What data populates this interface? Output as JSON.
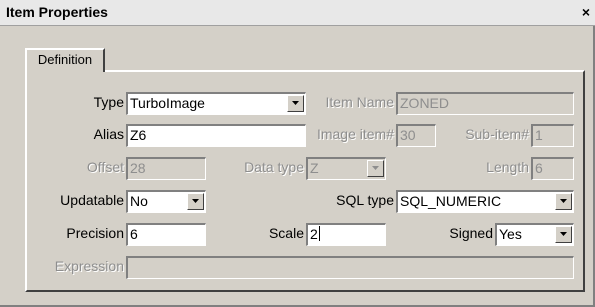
{
  "window": {
    "title": "Item Properties",
    "close_glyph": "×"
  },
  "tabs": [
    {
      "label": "Definition",
      "active": true
    }
  ],
  "form": {
    "type": {
      "label": "Type",
      "value": "TurboImage"
    },
    "item_name": {
      "label": "Item Name",
      "value": "ZONED"
    },
    "alias": {
      "label": "Alias",
      "value": "Z6"
    },
    "image_item": {
      "label": "Image item#",
      "value": "30"
    },
    "sub_item": {
      "label": "Sub-item#",
      "value": "1"
    },
    "offset": {
      "label": "Offset",
      "value": "28"
    },
    "data_type": {
      "label": "Data type",
      "value": "Z"
    },
    "length": {
      "label": "Length",
      "value": "6"
    },
    "updatable": {
      "label": "Updatable",
      "value": "No"
    },
    "sql_type": {
      "label": "SQL type",
      "value": "SQL_NUMERIC"
    },
    "precision": {
      "label": "Precision",
      "value": "6"
    },
    "scale": {
      "label": "Scale",
      "value": "2"
    },
    "signed": {
      "label": "Signed",
      "value": "Yes"
    },
    "expression": {
      "label": "Expression",
      "value": ""
    }
  },
  "icons": {
    "dropdown": "chevron-down-icon",
    "close": "close-icon"
  }
}
